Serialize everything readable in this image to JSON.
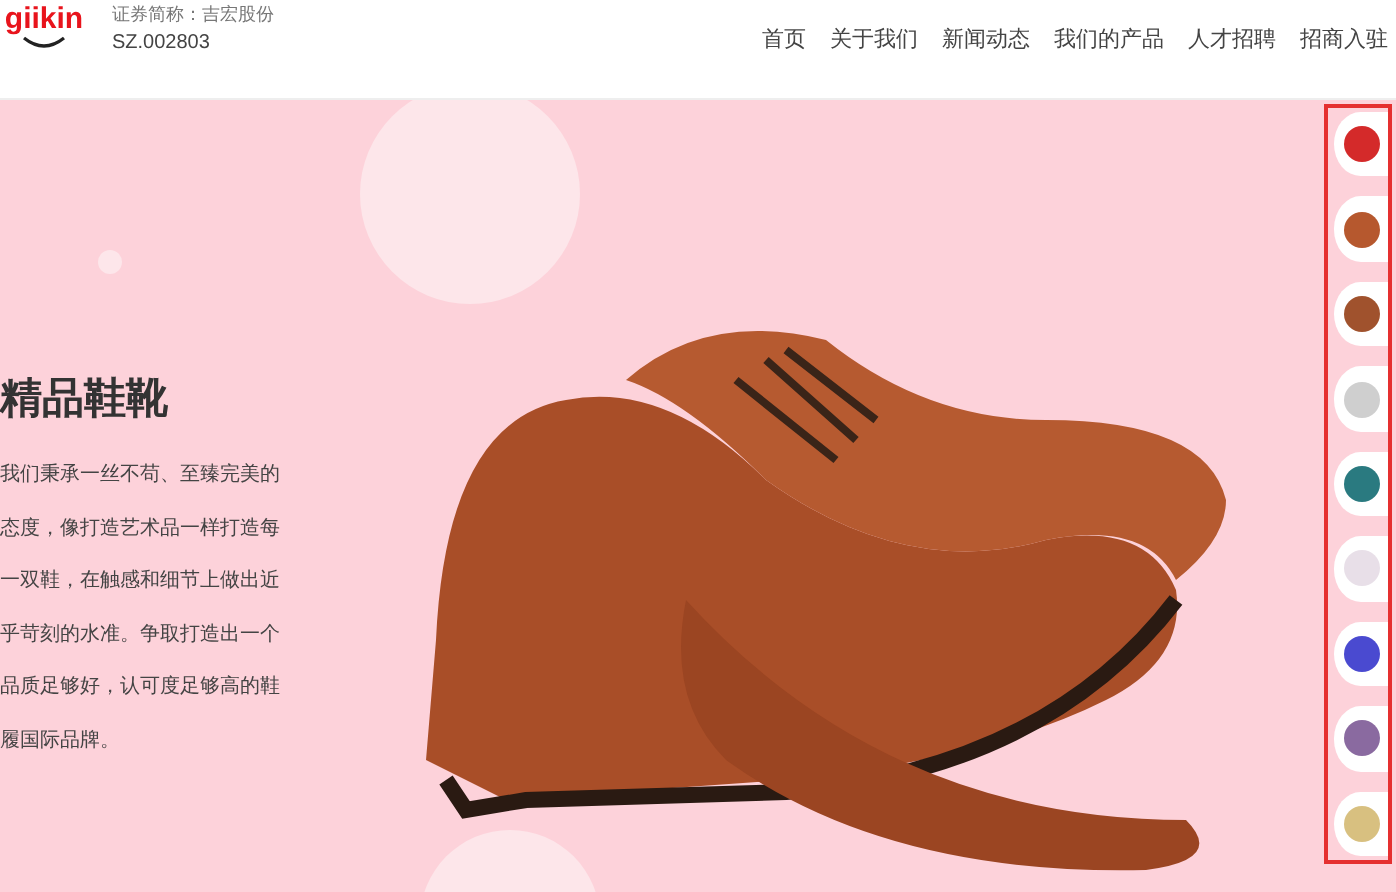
{
  "header": {
    "logo": "giikin",
    "stock_name": "证券简称：吉宏股份",
    "stock_code": "SZ.002803",
    "nav": [
      {
        "label": "首页"
      },
      {
        "label": "关于我们"
      },
      {
        "label": "新闻动态"
      },
      {
        "label": "我们的产品"
      },
      {
        "label": "人才招聘"
      },
      {
        "label": "招商入驻"
      }
    ]
  },
  "hero": {
    "title": "精品鞋靴",
    "description": "我们秉承一丝不苟、至臻完美的态度，像打造艺术品一样打造每一双鞋，在触感和细节上做出近乎苛刻的水准。争取打造出一个品质足够好，认可度足够高的鞋履国际品牌。"
  },
  "thumbnails": [
    {
      "kind": "photo"
    },
    {
      "kind": "photo"
    },
    {
      "kind": "photo"
    },
    {
      "kind": "photo"
    },
    {
      "kind": "photo"
    },
    {
      "kind": "photo"
    },
    {
      "kind": "photo"
    },
    {
      "kind": "photo"
    },
    {
      "kind": "photo"
    }
  ]
}
